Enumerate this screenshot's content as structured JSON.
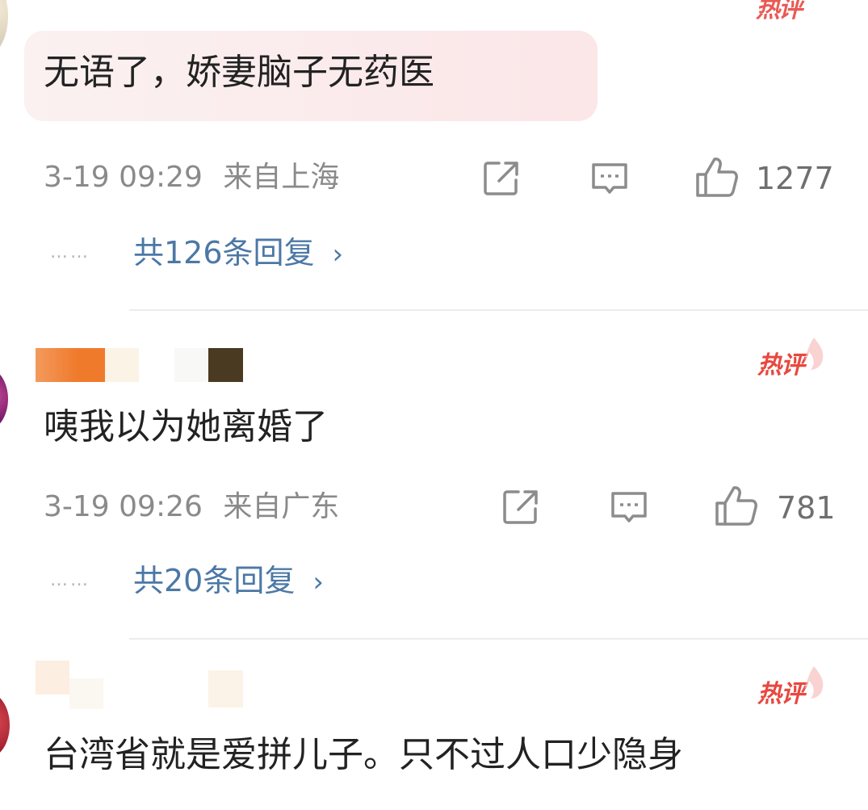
{
  "badge_label": "热评",
  "colors": {
    "accent_hot": "#e8483f",
    "reply_link": "#4c78a6",
    "meta_gray": "#8a8a8a"
  },
  "comments": [
    {
      "text": "无语了，娇妻脑子无药医",
      "time": "3-19 09:29",
      "location": "来自上海",
      "likes": "1277",
      "dots": "……",
      "replies": "共126条回复",
      "reply_chevron": "›"
    },
    {
      "text": "咦我以为她离婚了",
      "time": "3-19 09:26",
      "location": "来自广东",
      "likes": "781",
      "dots": "……",
      "replies": "共20条回复",
      "reply_chevron": "›"
    },
    {
      "text": "台湾省就是爱拼儿子。只不过人口少隐身"
    }
  ],
  "icons": {
    "share": "share-icon",
    "comment": "comment-icon",
    "like": "thumbs-up-icon",
    "hot": "flame-icon"
  }
}
